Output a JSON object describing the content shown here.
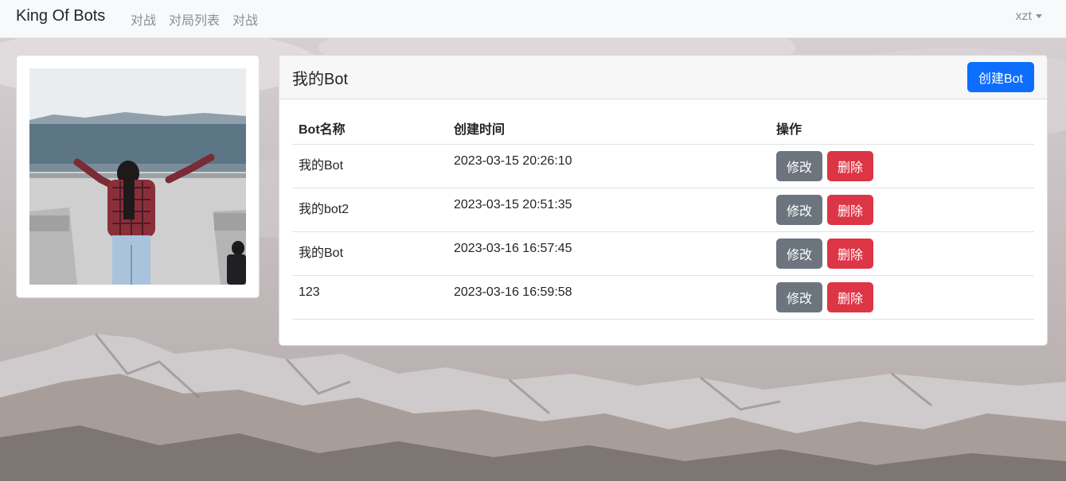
{
  "navbar": {
    "brand": "King Of Bots",
    "links": [
      "对战",
      "对局列表",
      "对战"
    ],
    "user": "xzt"
  },
  "bots_card": {
    "title": "我的Bot",
    "create_label": "创建Bot",
    "columns": [
      "Bot名称",
      "创建时间",
      "操作"
    ],
    "rows": [
      {
        "name": "我的Bot",
        "created": "2023-03-15 20:26:10"
      },
      {
        "name": "我的bot2",
        "created": "2023-03-15 20:51:35"
      },
      {
        "name": "我的Bot",
        "created": "2023-03-16 16:57:45"
      },
      {
        "name": "123",
        "created": "2023-03-16 16:59:58"
      }
    ],
    "edit_label": "修改",
    "delete_label": "删除"
  },
  "colors": {
    "primary": "#0d6efd",
    "secondary": "#6c757d",
    "danger": "#dc3545",
    "navbar": "#f8f9fa"
  }
}
